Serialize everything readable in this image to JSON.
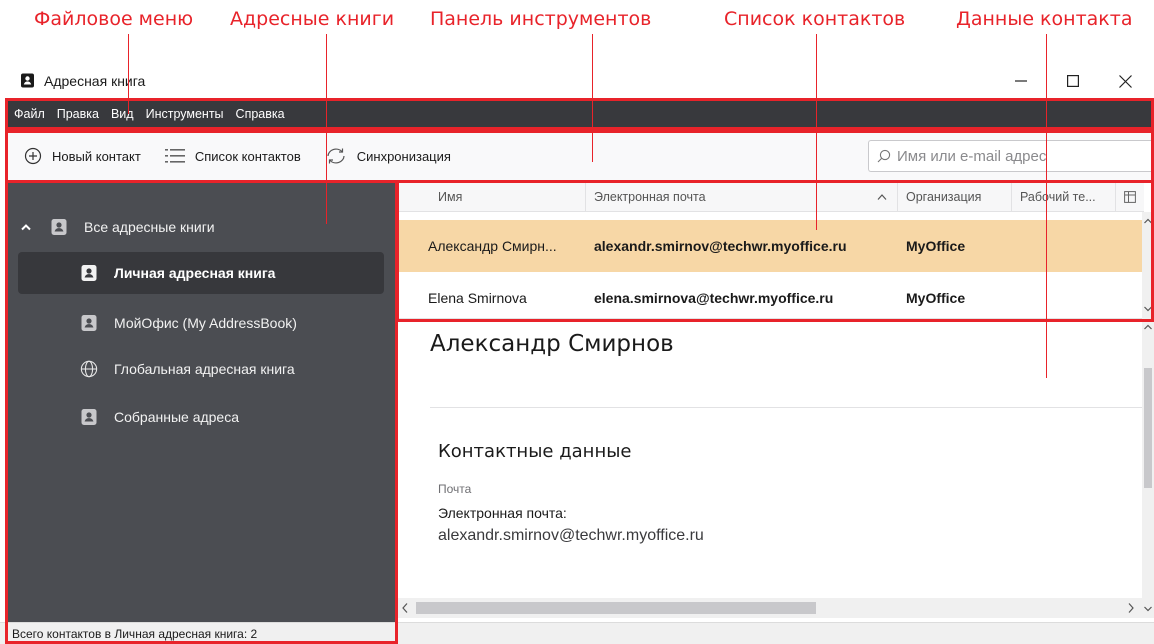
{
  "annotations": {
    "file_menu": "Файловое меню",
    "address_books": "Адресные книги",
    "toolbar": "Панель инструментов",
    "contact_list": "Список контактов",
    "contact_details": "Данные контакта"
  },
  "window": {
    "title": "Адресная книга",
    "controls": [
      "minimize-icon",
      "maximize-icon",
      "close-icon"
    ]
  },
  "menu": {
    "items": [
      "Файл",
      "Правка",
      "Вид",
      "Инструменты",
      "Справка"
    ]
  },
  "toolbar": {
    "new_contact": "Новый контакт",
    "contact_list": "Список контактов",
    "sync": "Синхронизация",
    "search_placeholder": "Имя или e-mail адрес"
  },
  "sidebar": {
    "root": "Все адресные книги",
    "items": [
      {
        "label": "Личная адресная книга",
        "icon": "contact-book-icon",
        "selected": true
      },
      {
        "label": "МойОфис (My AddressBook)",
        "icon": "contact-book-icon",
        "selected": false
      },
      {
        "label": "Глобальная адресная книга",
        "icon": "globe-icon",
        "selected": false
      },
      {
        "label": "Собранные адреса",
        "icon": "contact-book-icon",
        "selected": false
      }
    ]
  },
  "list": {
    "columns": [
      "Имя",
      "Электронная почта",
      "Организация",
      "Рабочий те..."
    ],
    "rows": [
      {
        "name": "Александр Смирн...",
        "email": "alexandr.smirnov@techwr.myoffice.ru",
        "org": "MyOffice",
        "selected": true
      },
      {
        "name": "Elena Smirnova",
        "email": "elena.smirnova@techwr.myoffice.ru",
        "org": "MyOffice",
        "selected": false
      }
    ]
  },
  "detail": {
    "name": "Александр Смирнов",
    "section": "Контактные данные",
    "subsection": "Почта",
    "email_label": "Электронная почта:",
    "email": "alexandr.smirnov@techwr.myoffice.ru"
  },
  "status": {
    "text": "Всего контактов в Личная адресная книга: 2"
  },
  "colors": {
    "annotation": "#e8232a",
    "menubar": "#38393d",
    "sidebar": "#4b4d52",
    "selected_row": "#f7d7a6"
  }
}
